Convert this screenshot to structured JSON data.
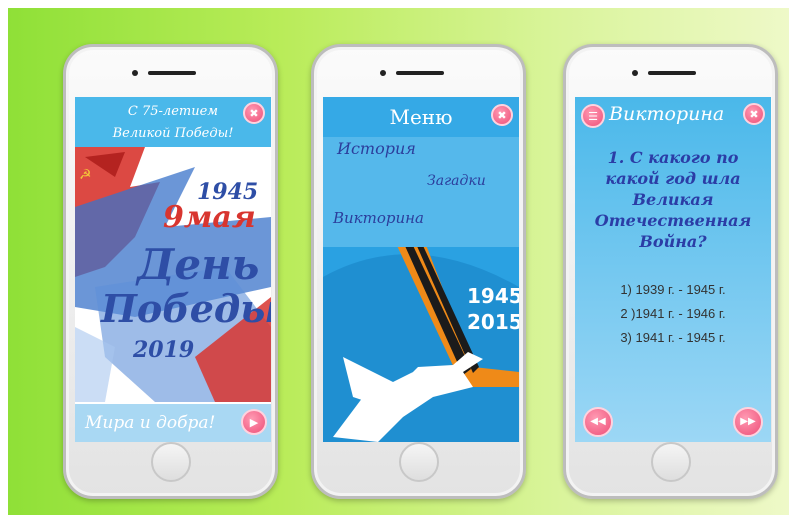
{
  "colors": {
    "background_start": "#8fe037",
    "background_end": "#eef9c8",
    "header_blue": "#4ab8ea",
    "accent_pink": "#ee4f78",
    "text_dark_blue": "#2b3da6"
  },
  "phone1": {
    "header_line1": "С 75-летием",
    "header_line2": "Великой Победы!",
    "poster": {
      "year_top": "1945",
      "date": "9мая",
      "title_line1": "День",
      "title_line2": "Победы",
      "year_bottom": "2019"
    },
    "footer_text": "Мира и добра!",
    "close_icon": "close-icon",
    "next_icon": "play-icon"
  },
  "phone2": {
    "title": "Меню",
    "menu_items": [
      "История",
      "Загадки",
      "Викторина"
    ],
    "year_top": "1945",
    "year_bottom": "2015",
    "close_icon": "close-icon"
  },
  "phone3": {
    "title": "Викторина",
    "question": "1. С какого по какой год шла Великая Отечественная Война?",
    "answers": [
      "1) 1939 г. - 1945 г.",
      "2 )1941 г. - 1946 г.",
      "3) 1941 г. - 1945 г."
    ],
    "menu_icon": "menu-icon",
    "close_icon": "close-icon",
    "prev_icon": "rewind-icon",
    "next_icon": "fast-forward-icon"
  }
}
